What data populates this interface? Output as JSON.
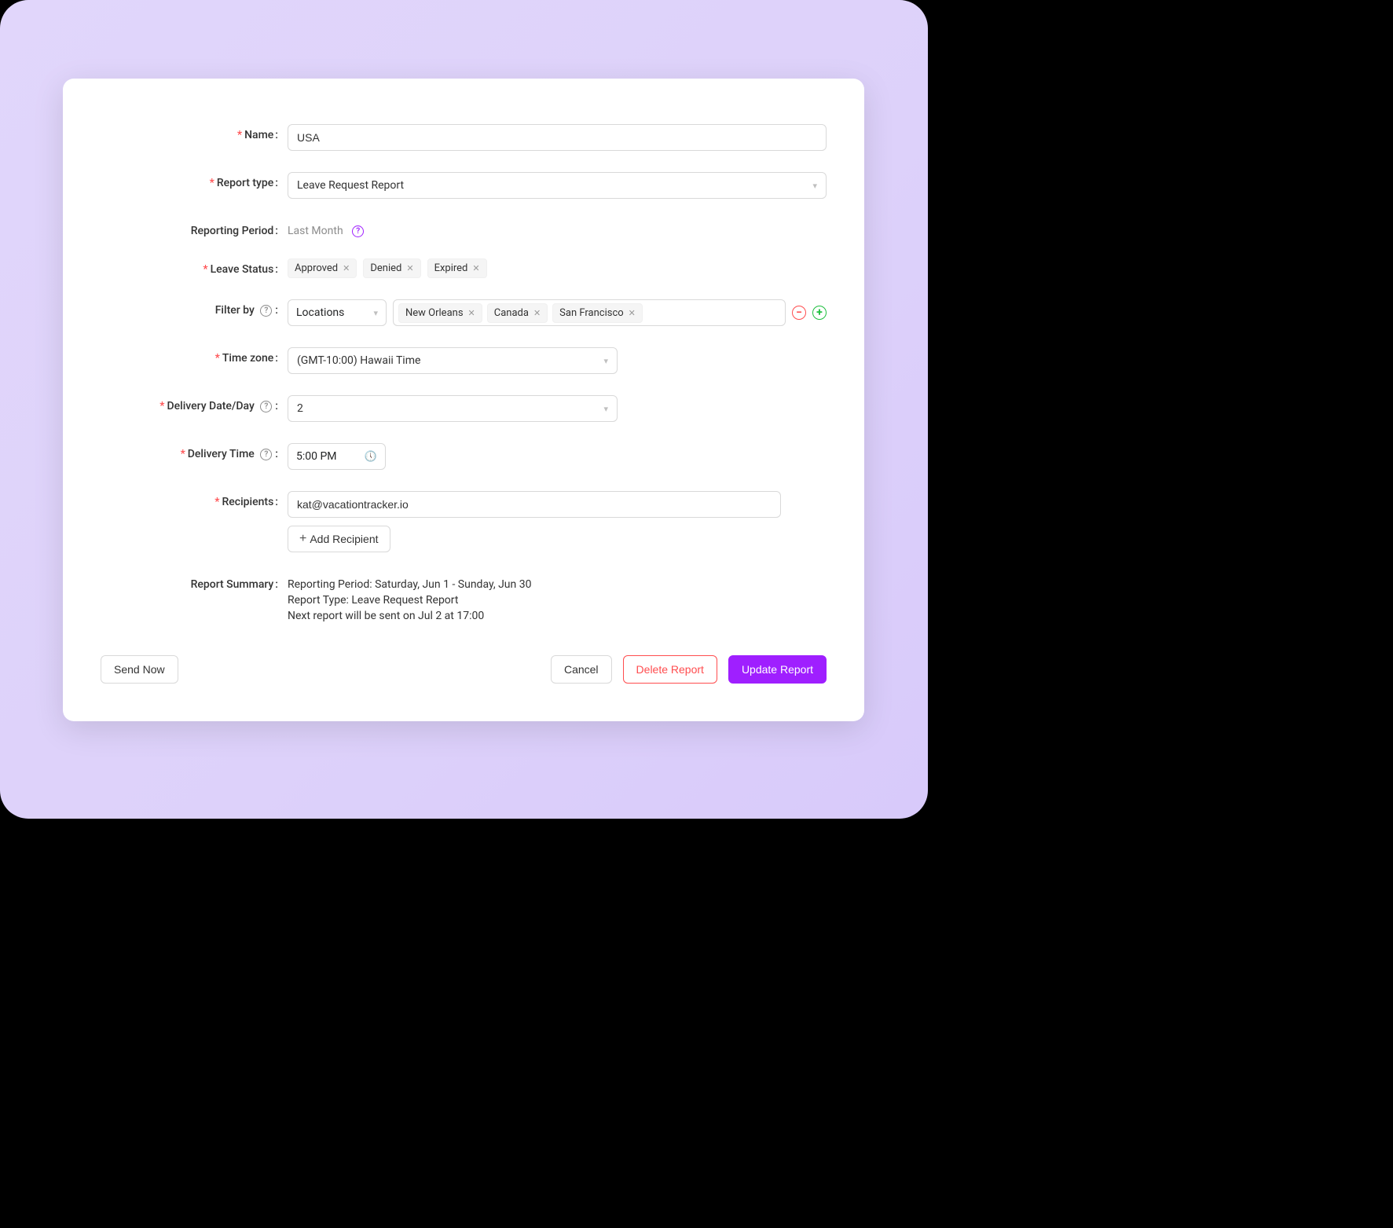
{
  "labels": {
    "name": "Name",
    "report_type": "Report type",
    "reporting_period": "Reporting Period",
    "leave_status": "Leave Status",
    "filter_by": "Filter by",
    "time_zone": "Time zone",
    "delivery_date": "Delivery Date/Day",
    "delivery_time": "Delivery Time",
    "recipients": "Recipients",
    "report_summary": "Report Summary"
  },
  "values": {
    "name": "USA",
    "report_type": "Leave Request Report",
    "reporting_period": "Last Month",
    "time_zone": "(GMT-10:00) Hawaii Time",
    "delivery_date": "2",
    "delivery_time": "5:00 PM",
    "recipient0": "kat@vacationtracker.io",
    "filter_type": "Locations"
  },
  "leave_status_tags": [
    "Approved",
    "Denied",
    "Expired"
  ],
  "filter_tags": [
    "New Orleans",
    "Canada",
    "San Francisco"
  ],
  "summary": {
    "line1": "Reporting Period: Saturday, Jun 1 - Sunday, Jun 30",
    "line2": "Report Type: Leave Request Report",
    "line3": "Next report will be sent on Jul 2 at 17:00"
  },
  "buttons": {
    "add_recipient": "Add Recipient",
    "send_now": "Send Now",
    "cancel": "Cancel",
    "delete": "Delete Report",
    "update": "Update Report"
  }
}
